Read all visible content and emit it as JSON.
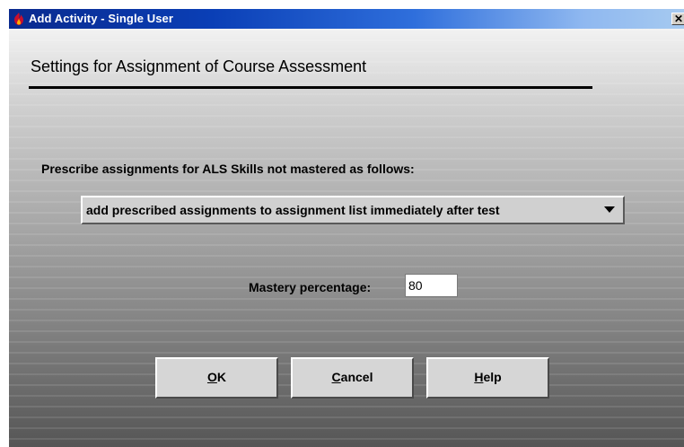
{
  "window": {
    "title": "Add Activity - Single User",
    "close_glyph": "✕"
  },
  "heading": "Settings for Assignment of Course Assessment",
  "prescribe": {
    "label": "Prescribe assignments for ALS Skills not mastered as follows:",
    "selected": "add prescribed assignments to assignment list immediately after test"
  },
  "mastery": {
    "label": "Mastery percentage:",
    "value": "80"
  },
  "buttons": {
    "ok": {
      "mnemonic": "O",
      "rest": "K"
    },
    "cancel": {
      "mnemonic": "C",
      "rest": "ancel"
    },
    "help": {
      "mnemonic": "H",
      "rest": "elp"
    }
  },
  "icons": {
    "app": "app-flame-icon",
    "dropdown": "chevron-down-icon",
    "close": "close-icon"
  },
  "colors": {
    "titlebar_start": "#0a2a8e",
    "titlebar_end": "#a6caf0",
    "button_face": "#d6d6d6"
  }
}
